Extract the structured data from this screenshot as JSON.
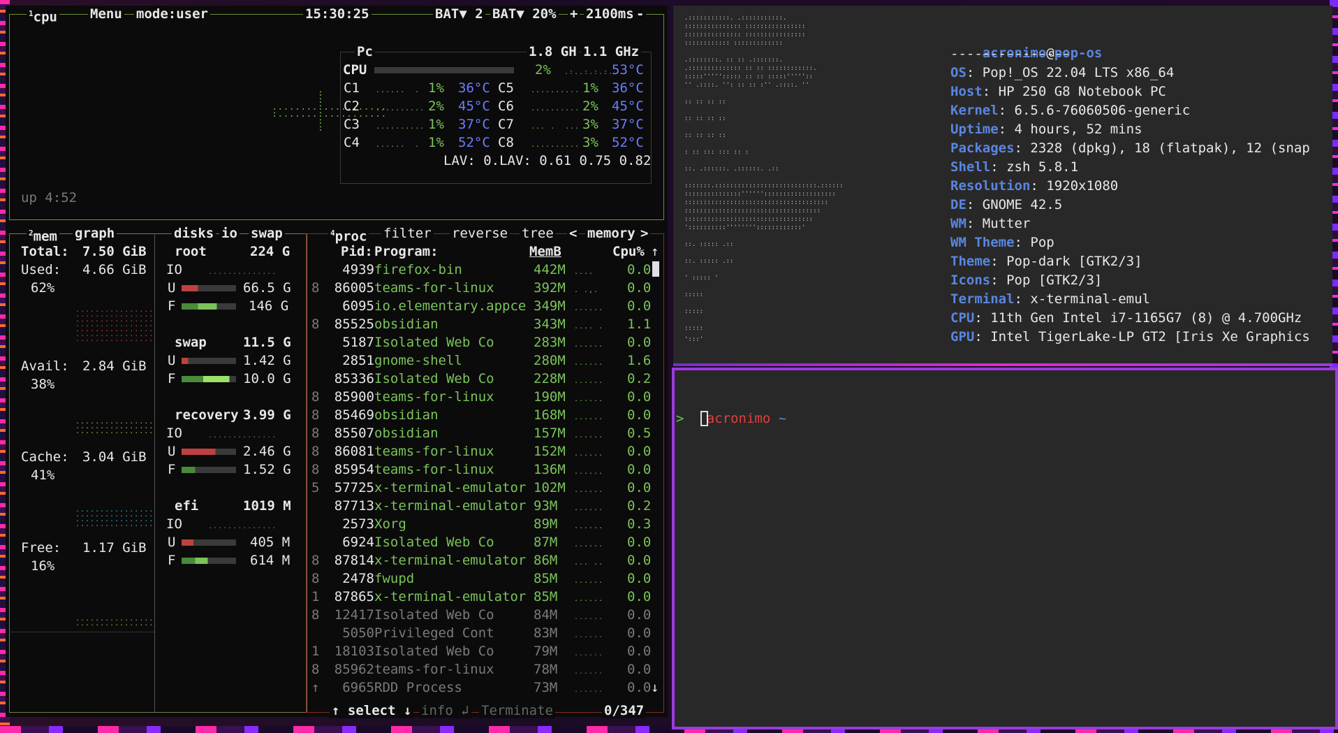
{
  "btop": {
    "cpu_box": {
      "title_num": "1",
      "title": "cpu",
      "menu": "Menu",
      "mode": "mode:user",
      "clock": "15:30:25",
      "bat1": "BAT▼ 2",
      "bat2": "BAT▼ 20%",
      "plus": "+",
      "interval": "2100ms",
      "minus": "-",
      "uptime": "up 4:52",
      "model": "Pc",
      "freq1": "1.8 GH",
      "freq2": "1.1 GHz",
      "cpu_label": "CPU",
      "cpu_pct": "2%",
      "cpu_temp": "53°C",
      "cores": [
        {
          "name": "C1",
          "pct": "1%",
          "temp": "36°C"
        },
        {
          "name": "C2",
          "pct": "2%",
          "temp": "45°C"
        },
        {
          "name": "C3",
          "pct": "1%",
          "temp": "37°C"
        },
        {
          "name": "C4",
          "pct": "1%",
          "temp": "52°C"
        },
        {
          "name": "C5",
          "pct": "1%",
          "temp": "36°C"
        },
        {
          "name": "C6",
          "pct": "2%",
          "temp": "45°C"
        },
        {
          "name": "C7",
          "pct": "3%",
          "temp": "37°C"
        },
        {
          "name": "C8",
          "pct": "3%",
          "temp": "52°C"
        }
      ],
      "lav": "LAV: 0.LAV: 0.61 0.75 0.82"
    },
    "mem_box": {
      "title_num": "2",
      "title": "mem",
      "graph": "graph",
      "total_label": "Total:",
      "total": "7.50 GiB",
      "used_label": "Used:",
      "used": "4.66 GiB",
      "used_pct": "62%",
      "avail_label": "Avail:",
      "avail": "2.84 GiB",
      "avail_pct": "38%",
      "cache_label": "Cache:",
      "cache": "3.04 GiB",
      "cache_pct": "41%",
      "free_label": "Free:",
      "free": "1.17 GiB",
      "free_pct": "16%"
    },
    "disks_box": {
      "title": "disks",
      "io": "io",
      "swap": "swap",
      "disks": [
        {
          "name": "root",
          "size": "224 G",
          "io": "IO",
          "u": "66.5 G",
          "f": "146 G"
        },
        {
          "name": "swap",
          "size": "11.5 G",
          "io": "",
          "u": "1.42 G",
          "f": "10.0 G"
        },
        {
          "name": "recovery",
          "size": "3.99 G",
          "io": "IO",
          "u": "2.46 G",
          "f": "1.52 G"
        },
        {
          "name": "efi",
          "size": "1019 M",
          "io": "IO",
          "u": "405 M",
          "f": "614 M"
        }
      ],
      "u_label": "U",
      "f_label": "F"
    },
    "proc_box": {
      "title_num": "4",
      "title": "proc",
      "filter": "filter",
      "reverse": "reverse",
      "tree": "tree",
      "sort_left": "<",
      "sort": "memory",
      "sort_right": ">",
      "col_pid": "Pid:",
      "col_program": "Program:",
      "col_mem": "MemB",
      "col_cpu": "Cpu%",
      "sort_arrow": "↑",
      "rows": [
        {
          "t": "",
          "pid": "4939",
          "prog": "firefox-bin",
          "mem": "442M",
          "cpu": "0.0"
        },
        {
          "t": "8",
          "pid": "86005",
          "prog": "teams-for-linux",
          "mem": "392M",
          "cpu": "0.0"
        },
        {
          "t": "",
          "pid": "6095",
          "prog": "io.elementary.appce",
          "mem": "349M",
          "cpu": "0.0"
        },
        {
          "t": "8",
          "pid": "85525",
          "prog": "obsidian",
          "mem": "343M",
          "cpu": "1.1"
        },
        {
          "t": "",
          "pid": "5187",
          "prog": "Isolated Web Co",
          "mem": "283M",
          "cpu": "0.0"
        },
        {
          "t": "",
          "pid": "2851",
          "prog": "gnome-shell",
          "mem": "280M",
          "cpu": "1.6"
        },
        {
          "t": "",
          "pid": "85336",
          "prog": "Isolated Web Co",
          "mem": "228M",
          "cpu": "0.2"
        },
        {
          "t": "8",
          "pid": "85900",
          "prog": "teams-for-linux",
          "mem": "190M",
          "cpu": "0.0"
        },
        {
          "t": "8",
          "pid": "85469",
          "prog": "obsidian",
          "mem": "168M",
          "cpu": "0.0"
        },
        {
          "t": "8",
          "pid": "85507",
          "prog": "obsidian",
          "mem": "157M",
          "cpu": "0.5"
        },
        {
          "t": "8",
          "pid": "86081",
          "prog": "teams-for-linux",
          "mem": "152M",
          "cpu": "0.0"
        },
        {
          "t": "8",
          "pid": "85954",
          "prog": "teams-for-linux",
          "mem": "136M",
          "cpu": "0.0"
        },
        {
          "t": "5",
          "pid": "57725",
          "prog": "x-terminal-emulator",
          "mem": "102M",
          "cpu": "0.0"
        },
        {
          "t": "",
          "pid": "87713",
          "prog": "x-terminal-emulator",
          "mem": "93M",
          "cpu": "0.2"
        },
        {
          "t": "",
          "pid": "2573",
          "prog": "Xorg",
          "mem": "89M",
          "cpu": "0.3"
        },
        {
          "t": "",
          "pid": "6924",
          "prog": "Isolated Web Co",
          "mem": "87M",
          "cpu": "0.0"
        },
        {
          "t": "8",
          "pid": "87814",
          "prog": "x-terminal-emulator",
          "mem": "86M",
          "cpu": "0.0"
        },
        {
          "t": "8",
          "pid": "2478",
          "prog": "fwupd",
          "mem": "85M",
          "cpu": "0.0"
        },
        {
          "t": "1",
          "pid": "87865",
          "prog": "x-terminal-emulator",
          "mem": "85M",
          "cpu": "0.0"
        },
        {
          "t": "8",
          "pid": "12417",
          "prog": "Isolated Web Co",
          "mem": "84M",
          "cpu": "0.0"
        },
        {
          "t": "",
          "pid": "5050",
          "prog": "Privileged Cont",
          "mem": "83M",
          "cpu": "0.0"
        },
        {
          "t": "1",
          "pid": "18103",
          "prog": "Isolated Web Co",
          "mem": "79M",
          "cpu": "0.0"
        },
        {
          "t": "8",
          "pid": "85962",
          "prog": "teams-for-linux",
          "mem": "78M",
          "cpu": "0.0"
        },
        {
          "t": "↑",
          "pid": "6965",
          "prog": "RDD Process",
          "mem": "73M",
          "cpu": "0.0"
        }
      ],
      "scroll_down": "↓",
      "select": "↑ select ↓",
      "info": "info ↲",
      "terminate": "Terminate",
      "count": "0/347"
    }
  },
  "neofetch": {
    "user": "acronimo",
    "at": "@",
    "host": "pop-os",
    "sep": "---------------",
    "lines": [
      {
        "k": "OS",
        "v": ": Pop!_OS 22.04 LTS x86_64"
      },
      {
        "k": "Host",
        "v": ": HP 250 G8 Notebook PC"
      },
      {
        "k": "Kernel",
        "v": ": 6.5.6-76060506-generic"
      },
      {
        "k": "Uptime",
        "v": ": 4 hours, 52 mins"
      },
      {
        "k": "Packages",
        "v": ": 2328 (dpkg), 18 (flatpak), 12 (snap"
      },
      {
        "k": "Shell",
        "v": ": zsh 5.8.1"
      },
      {
        "k": "Resolution",
        "v": ": 1920x1080"
      },
      {
        "k": "DE",
        "v": ": GNOME 42.5"
      },
      {
        "k": "WM",
        "v": ": Mutter"
      },
      {
        "k": "WM Theme",
        "v": ": Pop"
      },
      {
        "k": "Theme",
        "v": ": Pop-dark [GTK2/3]"
      },
      {
        "k": "Icons",
        "v": ": Pop [GTK2/3]"
      },
      {
        "k": "Terminal",
        "v": ": x-terminal-emul"
      },
      {
        "k": "CPU",
        "v": ": 11th Gen Intel i7-1165G7 (8) @ 4.700GHz"
      },
      {
        "k": "GPU",
        "v": ": Intel TigerLake-LP GT2 [Iris Xe Graphics"
      }
    ]
  },
  "shell": {
    "user": "acronimo",
    "dir": "~",
    "prompt": ">"
  },
  "colors": {
    "accent_pink": "#e02acb",
    "accent_purple": "#9a3adf",
    "green": "#7ac35a",
    "blue": "#6c7dff",
    "red": "#e0403a"
  }
}
